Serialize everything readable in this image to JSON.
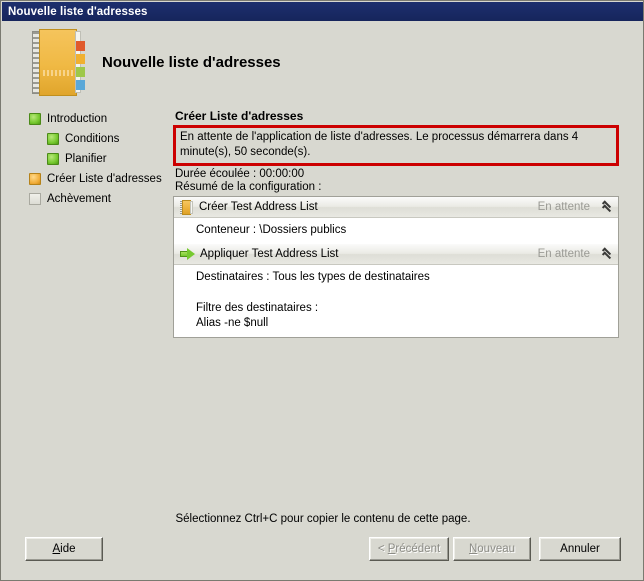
{
  "window": {
    "title": "Nouvelle liste d'adresses"
  },
  "header": {
    "title": "Nouvelle liste d'adresses",
    "icon": "address-book-icon"
  },
  "sidebar": {
    "items": [
      {
        "label": "Introduction",
        "state": "done",
        "indent": false
      },
      {
        "label": "Conditions",
        "state": "done",
        "indent": true
      },
      {
        "label": "Planifier",
        "state": "done",
        "indent": true
      },
      {
        "label": "Créer Liste d'adresses",
        "state": "active",
        "indent": false
      },
      {
        "label": "Achèvement",
        "state": "pending",
        "indent": false
      }
    ]
  },
  "main": {
    "section_title": "Créer Liste d'adresses",
    "wait_message": "En attente de l'application de liste d'adresses. Le processus démarrera dans 4 minute(s), 50 seconde(s).",
    "highlight_color": "#cc0000",
    "elapsed_label": "Durée écoulée : 00:00:00",
    "summary_label": "Résumé de la configuration :",
    "summary": [
      {
        "icon": "address-book-icon",
        "name": "Créer Test Address List",
        "status": "En attente",
        "collapse_icon": "chevron-up-double-icon",
        "lines": [
          "Conteneur : \\Dossiers publics"
        ]
      },
      {
        "icon": "green-arrow-icon",
        "name": "Appliquer Test Address List",
        "status": "En attente",
        "collapse_icon": "chevron-up-double-icon",
        "lines": [
          "Destinataires : Tous les types de destinataires",
          "",
          "Filtre des destinataires :",
          "Alias -ne $null"
        ]
      }
    ]
  },
  "footer": {
    "hint": "Sélectionnez Ctrl+C pour copier le contenu de cette page.",
    "buttons": [
      {
        "id": "aide",
        "prefix": "",
        "accel": "A",
        "suffix": "ide",
        "disabled": false
      },
      {
        "id": "prev",
        "prefix": "< ",
        "accel": "P",
        "suffix": "récédent",
        "disabled": true
      },
      {
        "id": "new",
        "prefix": "",
        "accel": "N",
        "suffix": "ouveau",
        "disabled": true
      },
      {
        "id": "cancel",
        "prefix": "",
        "accel": "",
        "suffix": "Annuler",
        "disabled": false
      }
    ]
  }
}
